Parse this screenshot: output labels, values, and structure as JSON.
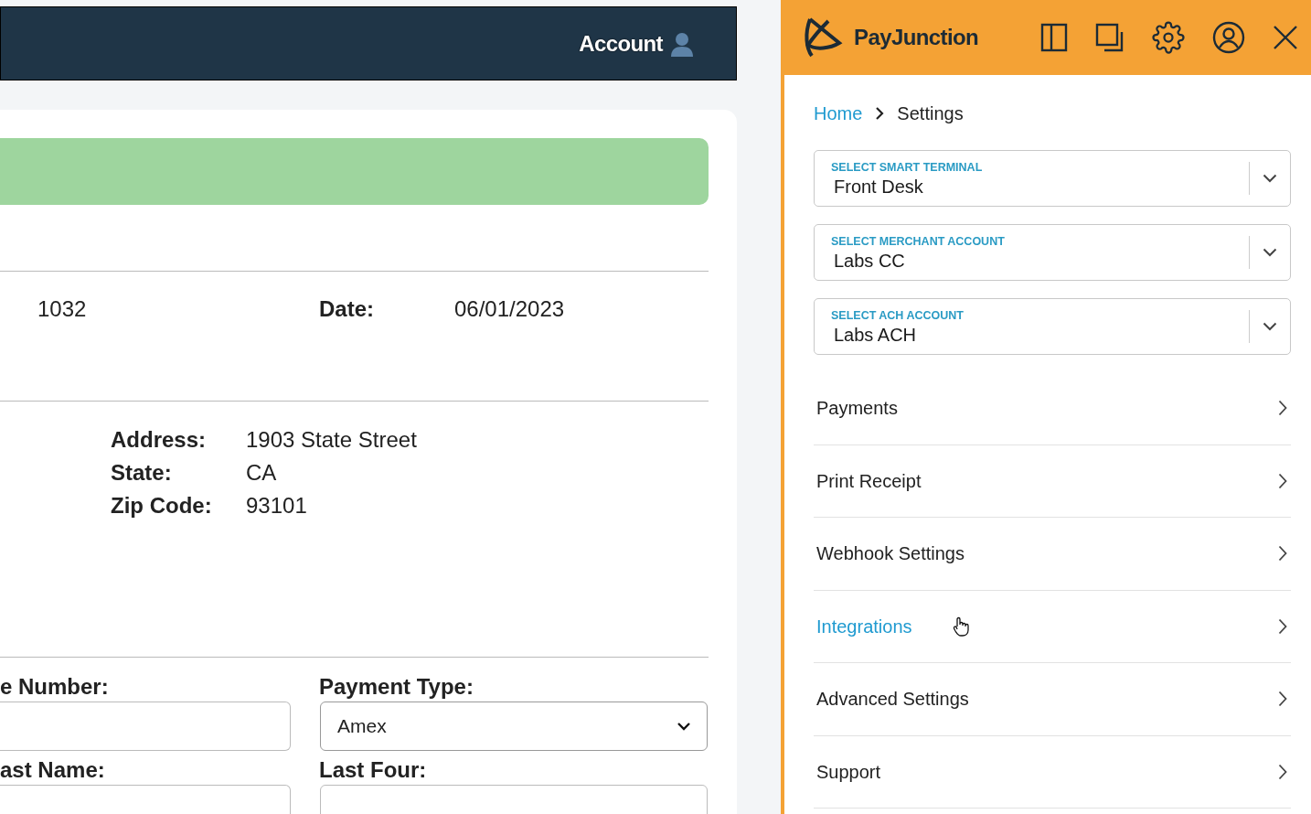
{
  "app_header": {
    "account_label": "Account"
  },
  "invoice": {
    "number_value": "1032",
    "date_label": "Date:",
    "date_value": "06/01/2023",
    "address_fields": [
      {
        "label": "Address:",
        "value": "1903 State Street"
      },
      {
        "label": "State:",
        "value": "CA"
      },
      {
        "label": "Zip Code:",
        "value": "93101"
      }
    ],
    "form_rows": [
      [
        {
          "label": "e Number:",
          "kind": "input"
        },
        {
          "label": "Payment Type:",
          "kind": "select",
          "value": "Amex"
        }
      ],
      [
        {
          "label": "ast Name:",
          "kind": "input"
        },
        {
          "label": "Last Four:",
          "kind": "input"
        }
      ]
    ]
  },
  "panel": {
    "brand": "PayJunction",
    "breadcrumb": [
      {
        "label": "Home",
        "link": true
      },
      {
        "label": "Settings",
        "link": false
      }
    ],
    "selects": [
      {
        "label": "SELECT SMART TERMINAL",
        "value": "Front Desk"
      },
      {
        "label": "SELECT MERCHANT ACCOUNT",
        "value": "Labs CC"
      },
      {
        "label": "SELECT ACH ACCOUNT",
        "value": "Labs ACH"
      }
    ],
    "menu": [
      {
        "label": "Payments",
        "selected": false
      },
      {
        "label": "Print Receipt",
        "selected": false
      },
      {
        "label": "Webhook Settings",
        "selected": false
      },
      {
        "label": "Integrations",
        "selected": true
      },
      {
        "label": "Advanced Settings",
        "selected": false
      },
      {
        "label": "Support",
        "selected": false
      }
    ]
  }
}
